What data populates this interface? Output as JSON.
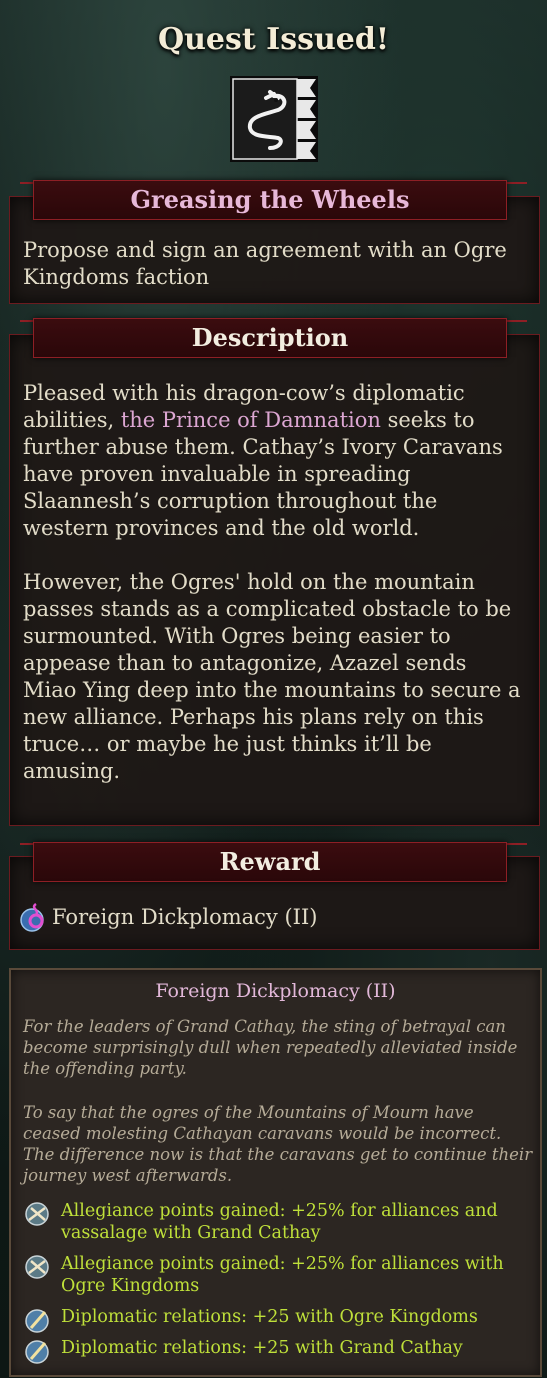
{
  "title": "Quest Issued!",
  "banner_icon": "dragon-banner-icon",
  "quest": {
    "name": "Greasing the Wheels",
    "objective": "Propose and sign an agreement with an Ogre Kingdoms faction"
  },
  "description": {
    "header": "Description",
    "p1_before": "Pleased with his dragon-cow’s diplomatic abilities, ",
    "p1_highlight": "the Prince of Damnation",
    "p1_after": " seeks to further abuse them. Cathay’s Ivory Caravans have proven invaluable in spreading Slaannesh’s corruption throughout the western provinces and the old world.",
    "p2": "However, the Ogres' hold on the mountain passes stands as a complicated obstacle to be surmounted. With Ogres being easier to appease than to antagonize, Azazel sends Miao Ying deep into the mountains to secure a new alliance. Perhaps his plans rely on this truce… or maybe he just thinks it’ll be amusing."
  },
  "reward": {
    "header": "Reward",
    "item_label": "Foreign Dickplomacy (II)",
    "item_icon": "slaanesh-orb-icon"
  },
  "tooltip": {
    "title": "Foreign Dickplomacy (II)",
    "desc1": "For the leaders of Grand Cathay, the sting of betrayal can become surprisingly dull when repeatedly alleviated inside the offending party.",
    "desc2": "To say that the ogres of the Mountains of Mourn have ceased molesting Cathayan caravans would be incorrect. The difference now is that the caravans get to continue their journey west afterwards.",
    "effects": [
      {
        "icon": "allegiance-icon",
        "text": "Allegiance points gained: +25% for alliances and vassalage with Grand Cathay"
      },
      {
        "icon": "allegiance-icon",
        "text": "Allegiance points gained: +25% for alliances with Ogre Kingdoms"
      },
      {
        "icon": "diplomacy-quill-icon",
        "text": "Diplomatic relations: +25 with Ogre Kingdoms"
      },
      {
        "icon": "diplomacy-quill-icon",
        "text": "Diplomatic relations: +25 with Grand Cathay"
      }
    ]
  },
  "colors": {
    "panel_border": "#8e1f25",
    "highlight_pink": "#dca6d2",
    "effect_green": "#bfe03a"
  }
}
